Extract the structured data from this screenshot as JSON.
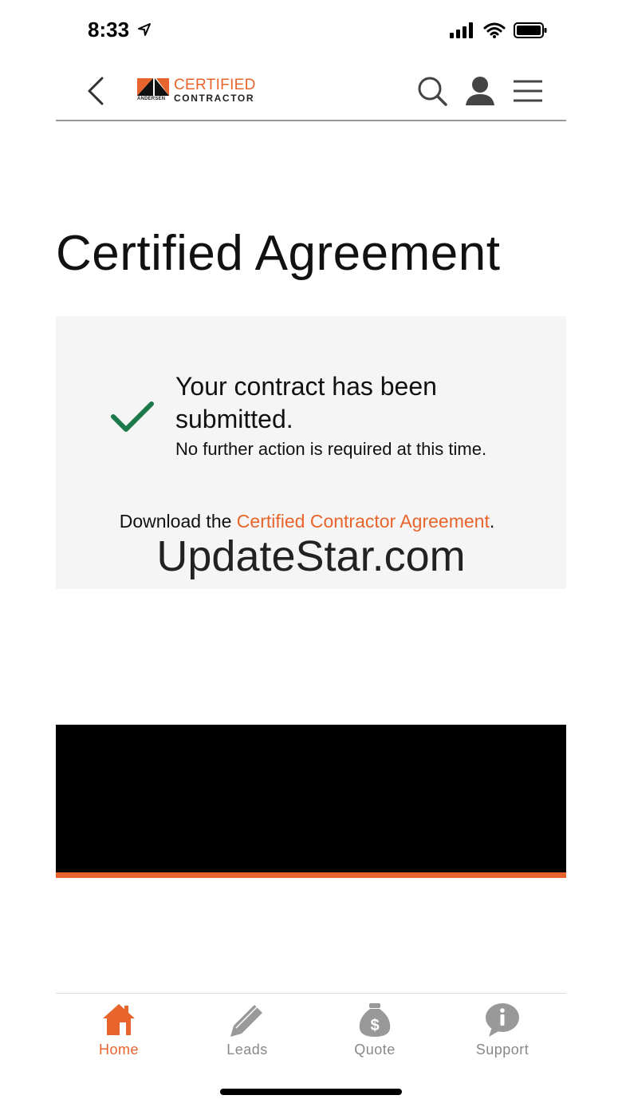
{
  "status_bar": {
    "time": "8:33"
  },
  "header": {
    "logo": {
      "line1": "CERTIFIED",
      "line2": "CONTRACTOR",
      "brand": "ANDERSEN"
    }
  },
  "page": {
    "title": "Certified Agreement"
  },
  "confirmation": {
    "heading": "Your contract has been submitted.",
    "subtext": "No further action is required at this time.",
    "download_prefix": "Download the ",
    "download_link": "Certified Contractor Agreement",
    "download_suffix": ".",
    "watermark": "UpdateStar.com"
  },
  "bottom_nav": {
    "items": [
      {
        "label": "Home",
        "icon": "home-icon",
        "active": true
      },
      {
        "label": "Leads",
        "icon": "pencil-icon",
        "active": false
      },
      {
        "label": "Quote",
        "icon": "money-bag-icon",
        "active": false
      },
      {
        "label": "Support",
        "icon": "info-icon",
        "active": false
      }
    ]
  },
  "colors": {
    "accent": "#e8642c",
    "check": "#1a7a4c",
    "panel_bg": "#f5f5f5",
    "nav_inactive": "#888888"
  }
}
